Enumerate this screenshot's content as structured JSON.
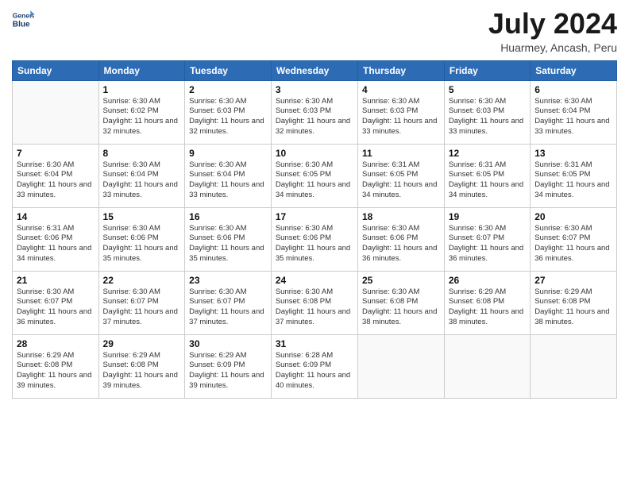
{
  "header": {
    "logo_line1": "General",
    "logo_line2": "Blue",
    "month_year": "July 2024",
    "location": "Huarmey, Ancash, Peru"
  },
  "calendar": {
    "days_of_week": [
      "Sunday",
      "Monday",
      "Tuesday",
      "Wednesday",
      "Thursday",
      "Friday",
      "Saturday"
    ],
    "weeks": [
      [
        {
          "day": "",
          "sunrise": "",
          "sunset": "",
          "daylight": ""
        },
        {
          "day": "1",
          "sunrise": "6:30 AM",
          "sunset": "6:02 PM",
          "daylight": "11 hours and 32 minutes."
        },
        {
          "day": "2",
          "sunrise": "6:30 AM",
          "sunset": "6:03 PM",
          "daylight": "11 hours and 32 minutes."
        },
        {
          "day": "3",
          "sunrise": "6:30 AM",
          "sunset": "6:03 PM",
          "daylight": "11 hours and 32 minutes."
        },
        {
          "day": "4",
          "sunrise": "6:30 AM",
          "sunset": "6:03 PM",
          "daylight": "11 hours and 33 minutes."
        },
        {
          "day": "5",
          "sunrise": "6:30 AM",
          "sunset": "6:03 PM",
          "daylight": "11 hours and 33 minutes."
        },
        {
          "day": "6",
          "sunrise": "6:30 AM",
          "sunset": "6:04 PM",
          "daylight": "11 hours and 33 minutes."
        }
      ],
      [
        {
          "day": "7",
          "sunrise": "6:30 AM",
          "sunset": "6:04 PM",
          "daylight": "11 hours and 33 minutes."
        },
        {
          "day": "8",
          "sunrise": "6:30 AM",
          "sunset": "6:04 PM",
          "daylight": "11 hours and 33 minutes."
        },
        {
          "day": "9",
          "sunrise": "6:30 AM",
          "sunset": "6:04 PM",
          "daylight": "11 hours and 33 minutes."
        },
        {
          "day": "10",
          "sunrise": "6:30 AM",
          "sunset": "6:05 PM",
          "daylight": "11 hours and 34 minutes."
        },
        {
          "day": "11",
          "sunrise": "6:31 AM",
          "sunset": "6:05 PM",
          "daylight": "11 hours and 34 minutes."
        },
        {
          "day": "12",
          "sunrise": "6:31 AM",
          "sunset": "6:05 PM",
          "daylight": "11 hours and 34 minutes."
        },
        {
          "day": "13",
          "sunrise": "6:31 AM",
          "sunset": "6:05 PM",
          "daylight": "11 hours and 34 minutes."
        }
      ],
      [
        {
          "day": "14",
          "sunrise": "6:31 AM",
          "sunset": "6:06 PM",
          "daylight": "11 hours and 34 minutes."
        },
        {
          "day": "15",
          "sunrise": "6:30 AM",
          "sunset": "6:06 PM",
          "daylight": "11 hours and 35 minutes."
        },
        {
          "day": "16",
          "sunrise": "6:30 AM",
          "sunset": "6:06 PM",
          "daylight": "11 hours and 35 minutes."
        },
        {
          "day": "17",
          "sunrise": "6:30 AM",
          "sunset": "6:06 PM",
          "daylight": "11 hours and 35 minutes."
        },
        {
          "day": "18",
          "sunrise": "6:30 AM",
          "sunset": "6:06 PM",
          "daylight": "11 hours and 36 minutes."
        },
        {
          "day": "19",
          "sunrise": "6:30 AM",
          "sunset": "6:07 PM",
          "daylight": "11 hours and 36 minutes."
        },
        {
          "day": "20",
          "sunrise": "6:30 AM",
          "sunset": "6:07 PM",
          "daylight": "11 hours and 36 minutes."
        }
      ],
      [
        {
          "day": "21",
          "sunrise": "6:30 AM",
          "sunset": "6:07 PM",
          "daylight": "11 hours and 36 minutes."
        },
        {
          "day": "22",
          "sunrise": "6:30 AM",
          "sunset": "6:07 PM",
          "daylight": "11 hours and 37 minutes."
        },
        {
          "day": "23",
          "sunrise": "6:30 AM",
          "sunset": "6:07 PM",
          "daylight": "11 hours and 37 minutes."
        },
        {
          "day": "24",
          "sunrise": "6:30 AM",
          "sunset": "6:08 PM",
          "daylight": "11 hours and 37 minutes."
        },
        {
          "day": "25",
          "sunrise": "6:30 AM",
          "sunset": "6:08 PM",
          "daylight": "11 hours and 38 minutes."
        },
        {
          "day": "26",
          "sunrise": "6:29 AM",
          "sunset": "6:08 PM",
          "daylight": "11 hours and 38 minutes."
        },
        {
          "day": "27",
          "sunrise": "6:29 AM",
          "sunset": "6:08 PM",
          "daylight": "11 hours and 38 minutes."
        }
      ],
      [
        {
          "day": "28",
          "sunrise": "6:29 AM",
          "sunset": "6:08 PM",
          "daylight": "11 hours and 39 minutes."
        },
        {
          "day": "29",
          "sunrise": "6:29 AM",
          "sunset": "6:08 PM",
          "daylight": "11 hours and 39 minutes."
        },
        {
          "day": "30",
          "sunrise": "6:29 AM",
          "sunset": "6:09 PM",
          "daylight": "11 hours and 39 minutes."
        },
        {
          "day": "31",
          "sunrise": "6:28 AM",
          "sunset": "6:09 PM",
          "daylight": "11 hours and 40 minutes."
        },
        {
          "day": "",
          "sunrise": "",
          "sunset": "",
          "daylight": ""
        },
        {
          "day": "",
          "sunrise": "",
          "sunset": "",
          "daylight": ""
        },
        {
          "day": "",
          "sunrise": "",
          "sunset": "",
          "daylight": ""
        }
      ]
    ]
  }
}
